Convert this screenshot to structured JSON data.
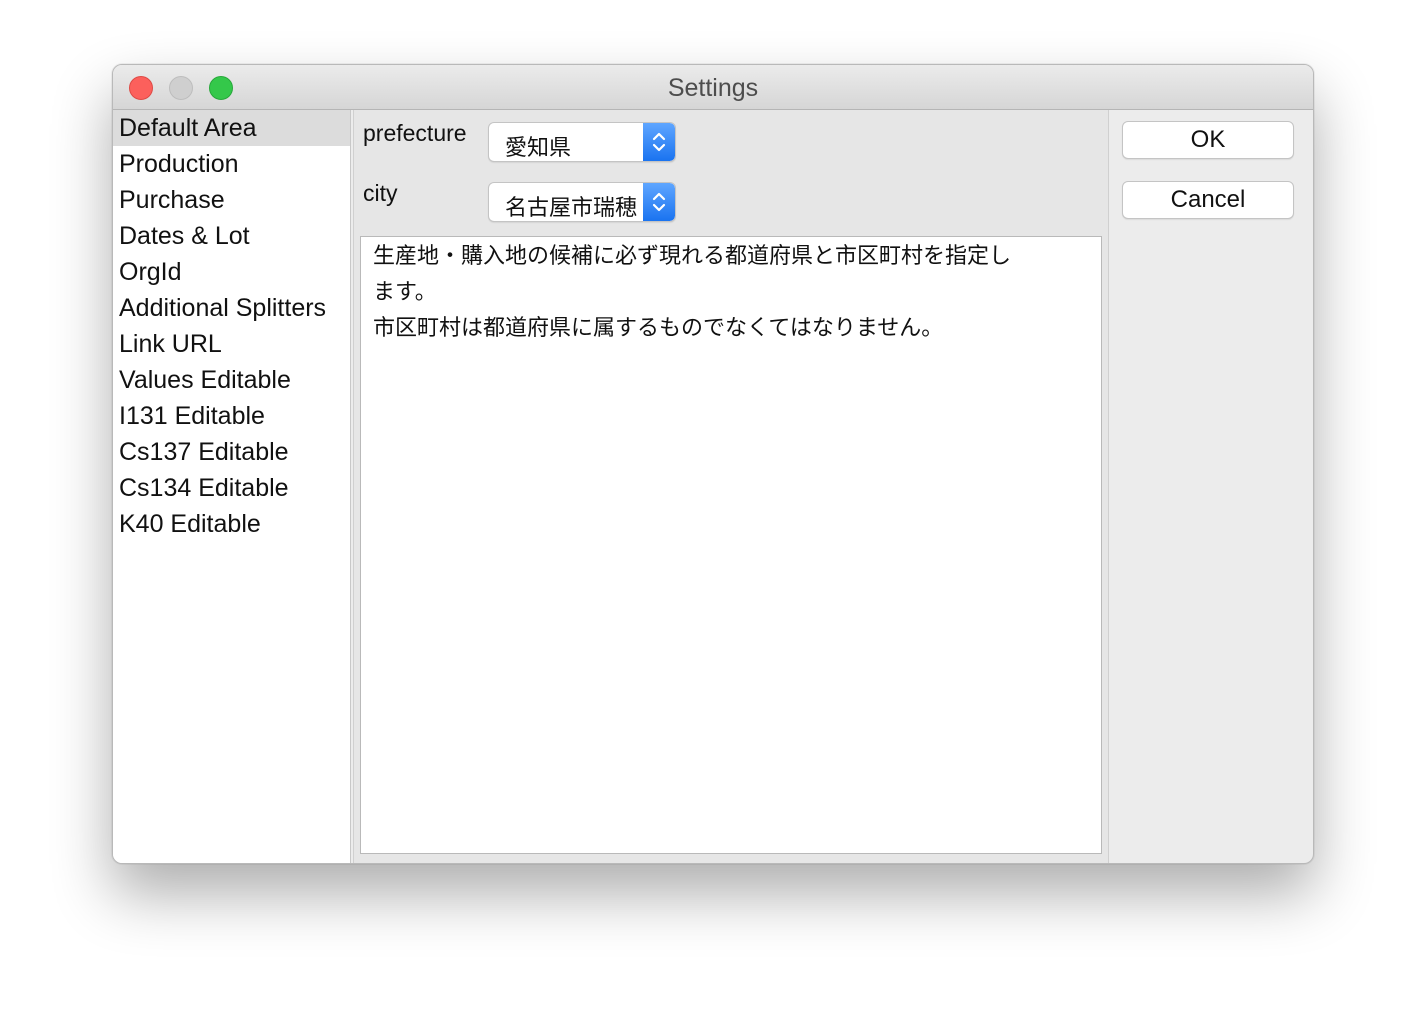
{
  "window": {
    "title": "Settings"
  },
  "sidebar": {
    "items": [
      {
        "label": "Default Area",
        "selected": true
      },
      {
        "label": "Production"
      },
      {
        "label": "Purchase"
      },
      {
        "label": "Dates & Lot"
      },
      {
        "label": "OrgId"
      },
      {
        "label": "Additional Splitters"
      },
      {
        "label": "Link URL"
      },
      {
        "label": "Values Editable"
      },
      {
        "label": "I131 Editable"
      },
      {
        "label": "Cs137 Editable"
      },
      {
        "label": "Cs134 Editable"
      },
      {
        "label": "K40 Editable"
      }
    ]
  },
  "main": {
    "prefecture_label": "prefecture",
    "prefecture_value": "愛知県",
    "city_label": "city",
    "city_value": "名古屋市瑞穂",
    "description_lines": [
      "生産地・購入地の候補に必ず現れる都道府県と市区町村を指定し",
      "ます。",
      "市区町村は都道府県に属するものでなくてはなりません。"
    ]
  },
  "buttons": {
    "ok_label": "OK",
    "cancel_label": "Cancel"
  },
  "icons": {
    "close": "close-window-icon",
    "minimize": "minimize-window-icon",
    "zoom": "zoom-window-icon",
    "popup_arrows": "chevron-up-down-icon"
  },
  "colors": {
    "accent": "#1a73f0",
    "close": "#fc605c",
    "zoom": "#34c84a"
  }
}
